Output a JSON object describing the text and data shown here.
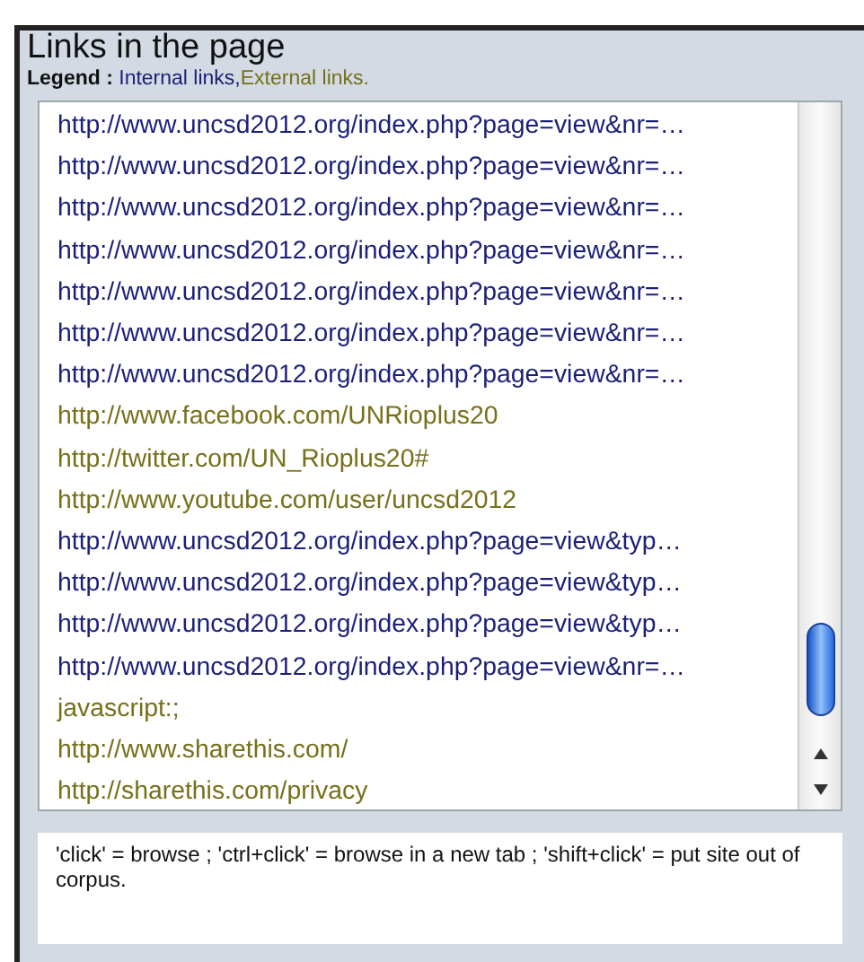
{
  "panel": {
    "title": "Links in the page"
  },
  "legend": {
    "label": "Legend :",
    "items": [
      {
        "text": "Internal links,",
        "kind": "internal"
      },
      {
        "text": "External links.",
        "kind": "external"
      }
    ]
  },
  "links": [
    {
      "url": "http://www.uncsd2012.org/index.php?page=view&nr=…",
      "kind": "internal"
    },
    {
      "url": "http://www.uncsd2012.org/index.php?page=view&nr=…",
      "kind": "internal"
    },
    {
      "url": "http://www.uncsd2012.org/index.php?page=view&nr=…",
      "kind": "internal"
    },
    {
      "url": "http://www.uncsd2012.org/index.php?page=view&nr=…",
      "kind": "internal"
    },
    {
      "url": "http://www.uncsd2012.org/index.php?page=view&nr=…",
      "kind": "internal"
    },
    {
      "url": "http://www.uncsd2012.org/index.php?page=view&nr=…",
      "kind": "internal"
    },
    {
      "url": "http://www.uncsd2012.org/index.php?page=view&nr=…",
      "kind": "internal"
    },
    {
      "url": "http://www.facebook.com/UNRioplus20",
      "kind": "external"
    },
    {
      "url": "http://twitter.com/UN_Rioplus20#",
      "kind": "external"
    },
    {
      "url": "http://www.youtube.com/user/uncsd2012",
      "kind": "external"
    },
    {
      "url": "http://www.uncsd2012.org/index.php?page=view&typ…",
      "kind": "internal"
    },
    {
      "url": "http://www.uncsd2012.org/index.php?page=view&typ…",
      "kind": "internal"
    },
    {
      "url": "http://www.uncsd2012.org/index.php?page=view&typ…",
      "kind": "internal"
    },
    {
      "url": "http://www.uncsd2012.org/index.php?page=view&nr=…",
      "kind": "internal"
    },
    {
      "url": "javascript:;",
      "kind": "external"
    },
    {
      "url": "http://www.sharethis.com/",
      "kind": "external"
    },
    {
      "url": "http://sharethis.com/privacy",
      "kind": "external"
    }
  ],
  "help": {
    "text": "'click' = browse ; 'ctrl+click' = browse in a new tab ;  'shift+click' = put site out of corpus."
  }
}
